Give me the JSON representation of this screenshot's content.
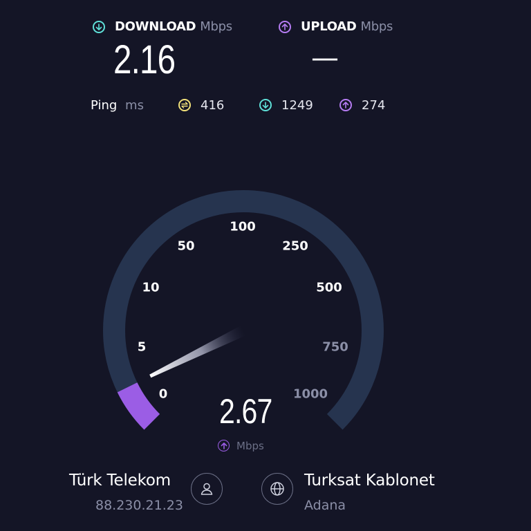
{
  "download": {
    "label": "DOWNLOAD",
    "unit": "Mbps",
    "value": "2.16",
    "icon": "download-arrow-icon",
    "color": "#5fe0d8"
  },
  "upload": {
    "label": "UPLOAD",
    "unit": "Mbps",
    "value": "—",
    "icon": "upload-arrow-icon",
    "color": "#b57cf2"
  },
  "ping": {
    "label": "Ping",
    "unit": "ms",
    "idle": {
      "value": "416",
      "icon": "ping-idle-icon",
      "color": "#f2e17a"
    },
    "download": {
      "value": "1249",
      "icon": "ping-download-icon",
      "color": "#5fe0d8"
    },
    "upload": {
      "value": "274",
      "icon": "ping-upload-icon",
      "color": "#b57cf2"
    }
  },
  "gauge": {
    "ticks": [
      "0",
      "5",
      "10",
      "50",
      "100",
      "250",
      "500",
      "750",
      "1000"
    ],
    "current_value": "2.67",
    "unit": "Mbps",
    "progress_fraction": 0.07,
    "track_color": "#26344f",
    "fill_color": "#9b5de5"
  },
  "isp": {
    "name": "Türk Telekom",
    "ip": "88.230.21.23"
  },
  "server": {
    "name": "Turksat Kablonet",
    "location": "Adana"
  }
}
